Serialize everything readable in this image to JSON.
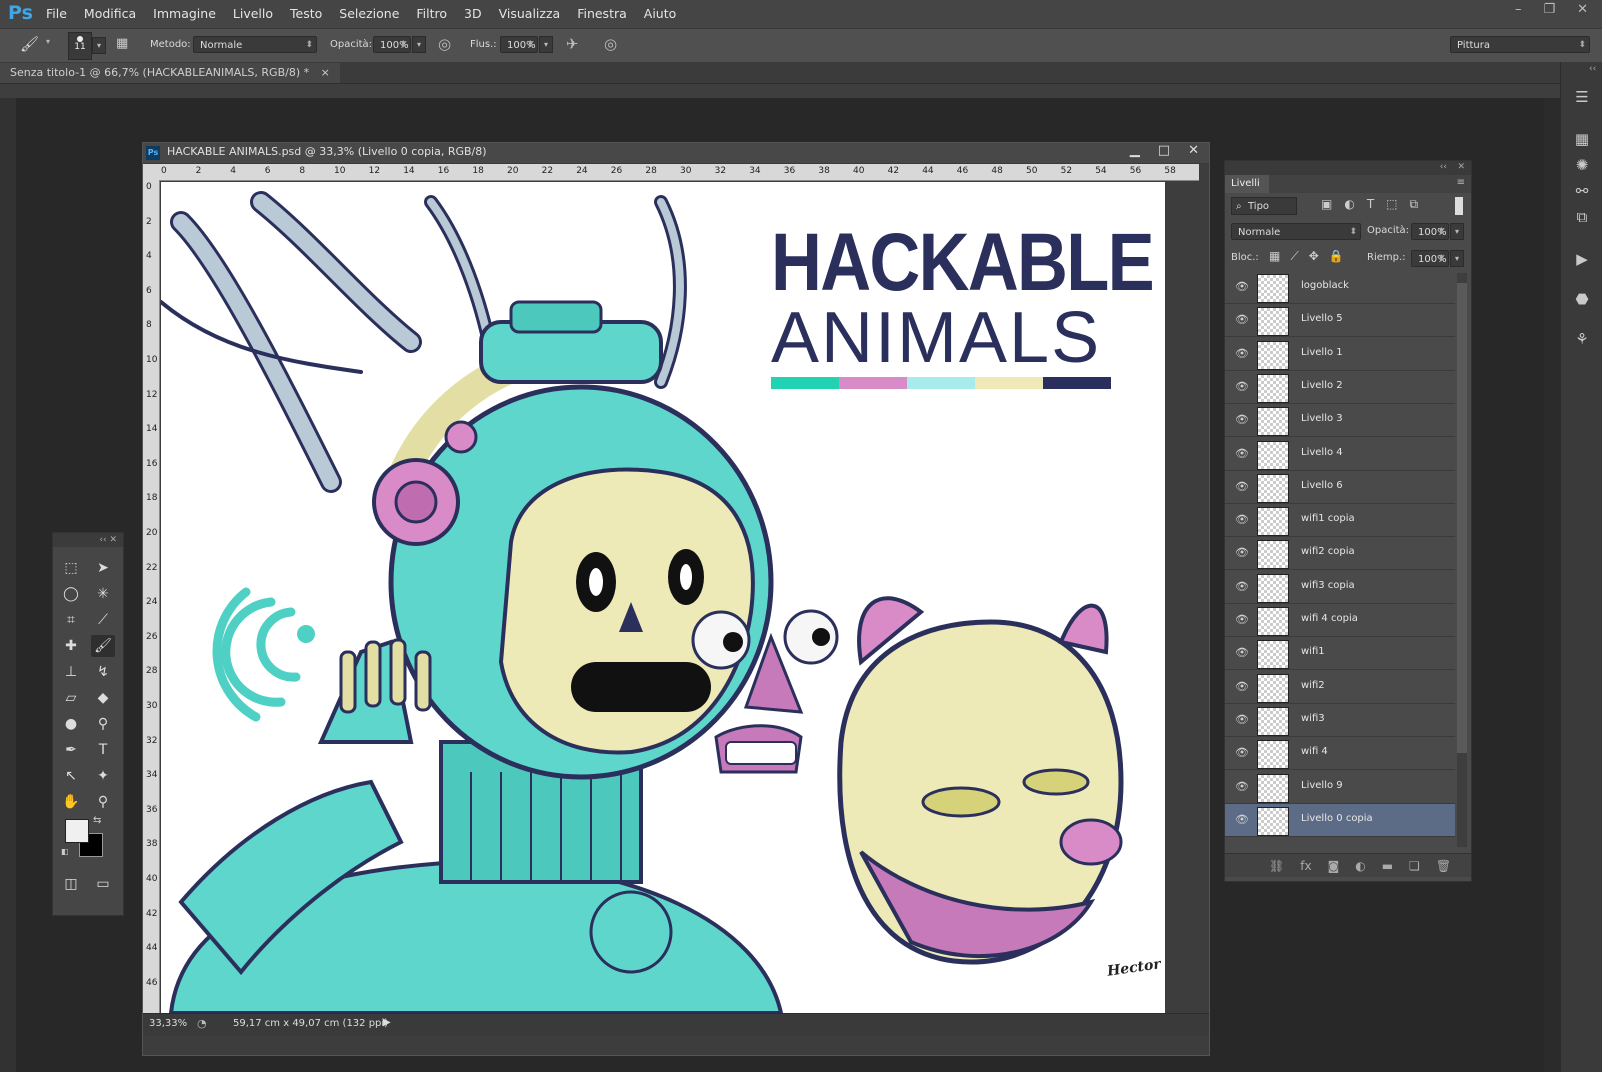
{
  "app": {
    "logo": "Ps"
  },
  "menu": [
    "File",
    "Modifica",
    "Immagine",
    "Livello",
    "Testo",
    "Selezione",
    "Filtro",
    "3D",
    "Visualizza",
    "Finestra",
    "Aiuto"
  ],
  "options": {
    "brush_size": "11",
    "method_label": "Metodo:",
    "method_value": "Normale",
    "opacity_label": "Opacità:",
    "opacity_value": "100%",
    "flow_label": "Flus.:",
    "flow_value": "100%",
    "workspace": "Pittura"
  },
  "tab": {
    "title": "Senza titolo-1 @ 66,7% (HACKABLEANIMALS, RGB/8) *",
    "close": "×"
  },
  "document": {
    "title": "HACKABLE ANIMALS.psd @ 33,3% (Livello 0 copia, RGB/8)",
    "zoom": "33,33%",
    "size_info": "59,17 cm x 49,07 cm (132 ppi)",
    "h_ruler": [
      "0",
      "2",
      "4",
      "6",
      "8",
      "10",
      "12",
      "14",
      "16",
      "18",
      "20",
      "22",
      "24",
      "26",
      "28",
      "30",
      "32",
      "34",
      "36",
      "38",
      "40",
      "42",
      "44",
      "46",
      "48",
      "50",
      "52",
      "54",
      "56",
      "58"
    ],
    "v_ruler": [
      "0",
      "2",
      "4",
      "6",
      "8",
      "10",
      "12",
      "14",
      "16",
      "18",
      "20",
      "22",
      "24",
      "26",
      "28",
      "30",
      "32",
      "34",
      "36",
      "38",
      "40",
      "42",
      "44",
      "46"
    ]
  },
  "artwork": {
    "logo_line1": "HACKABLE",
    "logo_line2": "ANIMALS",
    "stripe_colors": [
      "#21d3b3",
      "#d98bc8",
      "#a8ebec",
      "#eeeab8",
      "#2b2f5c"
    ],
    "signature": "Hector"
  },
  "layers_panel": {
    "title": "Livelli",
    "filter_label": "Tipo",
    "blend_mode": "Normale",
    "opacity_label": "Opacità:",
    "opacity_value": "100%",
    "lock_label": "Bloc.:",
    "fill_label": "Riemp.:",
    "fill_value": "100%",
    "layers": [
      "logoblack",
      "Livello 5",
      "Livello 1",
      "Livello 2",
      "Livello 3",
      "Livello 4",
      "Livello 6",
      "wifi1 copia",
      "wifi2 copia",
      "wifi3 copia",
      "wifi 4 copia",
      "wifi1",
      "wifi2",
      "wifi3",
      "wifi 4",
      "Livello 9",
      "Livello 0 copia"
    ],
    "selected": "Livello 0 copia"
  }
}
